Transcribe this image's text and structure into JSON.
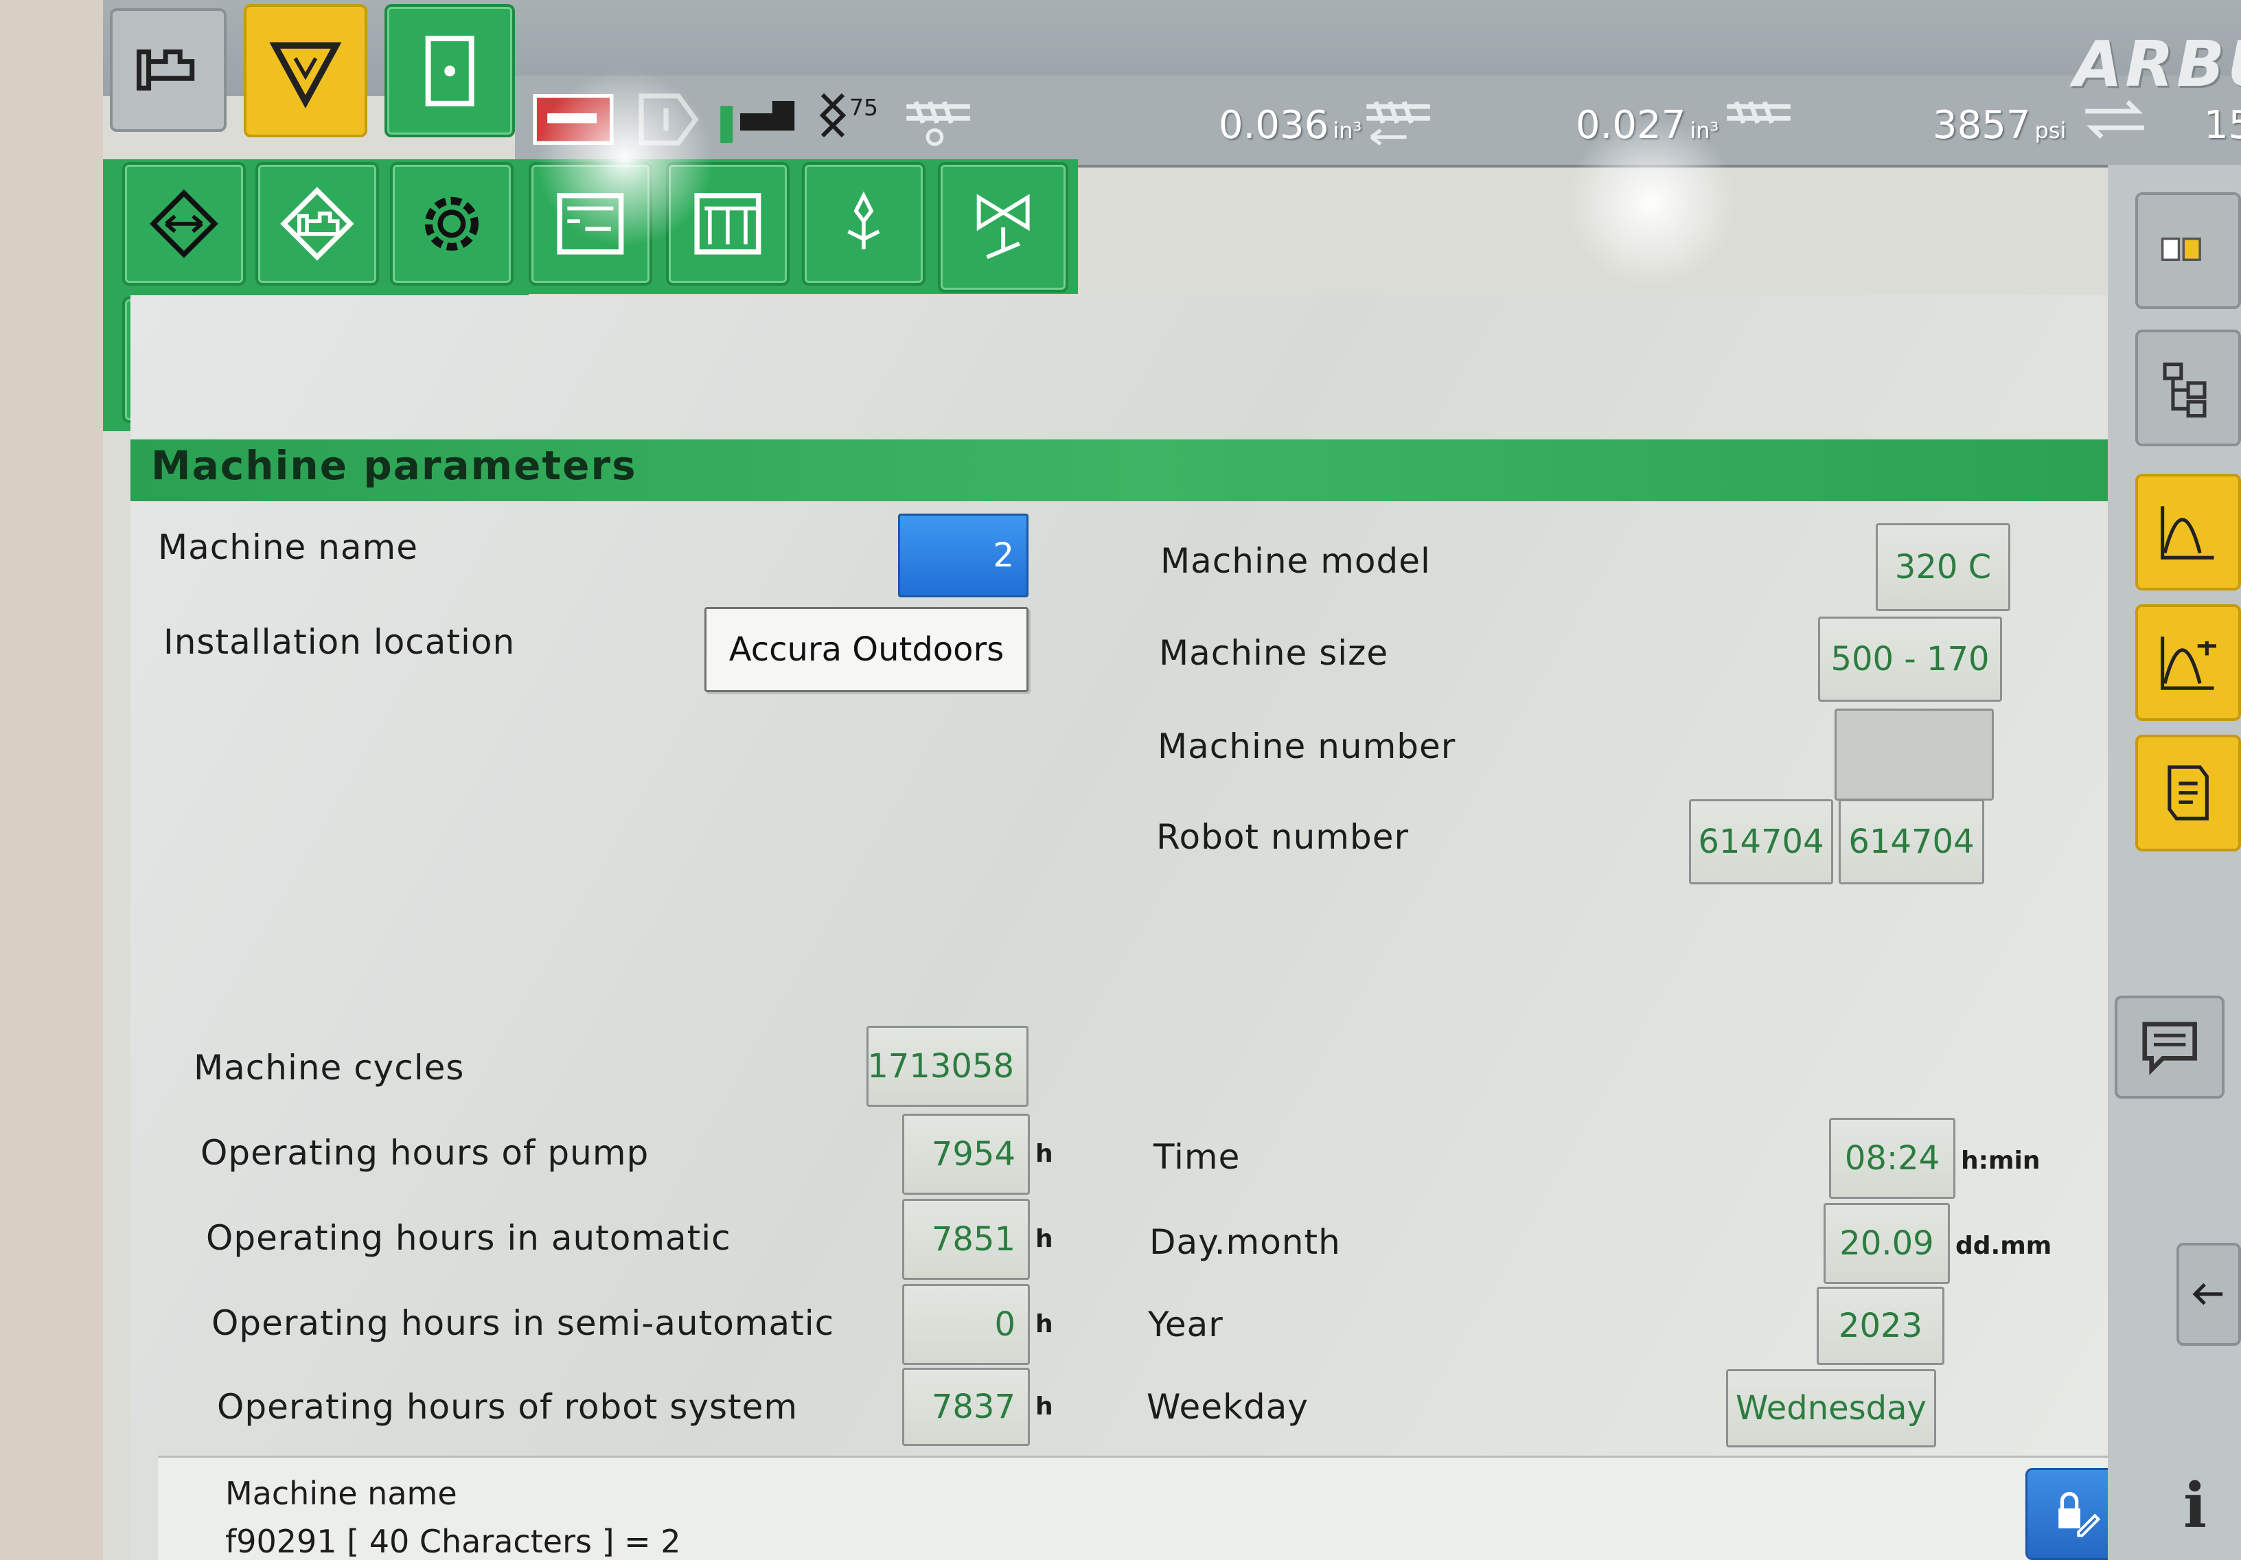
{
  "logo": {
    "text": "ARBU"
  },
  "statusbar": {
    "item1": {
      "value": "0.036",
      "unit": "in³"
    },
    "item2": {
      "value": "0.027",
      "unit": "in³"
    },
    "item3": {
      "value": "3857",
      "unit": "psi"
    },
    "item4": {
      "value": "15"
    },
    "percent_icon_text": "75 %"
  },
  "page": {
    "title": "Machine parameters"
  },
  "fields": {
    "machine_name": {
      "label": "Machine name",
      "value": "2"
    },
    "installation_location": {
      "label": "Installation location",
      "value": "Accura Outdoors"
    },
    "machine_model": {
      "label": "Machine model",
      "value": "320 C"
    },
    "machine_size": {
      "label": "Machine size",
      "value": "500 - 170"
    },
    "machine_number": {
      "label": "Machine number",
      "value": ""
    },
    "robot_number": {
      "label": "Robot number",
      "value1": "614704",
      "value2": "614704"
    },
    "machine_cycles": {
      "label": "Machine cycles",
      "value": "1713058"
    },
    "hours_pump": {
      "label": "Operating hours of pump",
      "value": "7954",
      "unit": "h"
    },
    "hours_automatic": {
      "label": "Operating hours in automatic",
      "value": "7851",
      "unit": "h"
    },
    "hours_semi": {
      "label": "Operating hours in semi-automatic",
      "value": "0",
      "unit": "h"
    },
    "hours_robot": {
      "label": "Operating hours of robot system",
      "value": "7837",
      "unit": "h"
    },
    "time": {
      "label": "Time",
      "value": "08:24",
      "unit": "h:min"
    },
    "day_month": {
      "label": "Day.month",
      "value": "20.09",
      "unit": "dd.mm"
    },
    "year": {
      "label": "Year",
      "value": "2023"
    },
    "weekday": {
      "label": "Weekday",
      "value": "Wednesday"
    }
  },
  "help": {
    "title": "Machine name",
    "text": "f90291 [ 40 Characters ] = 2"
  },
  "info_button": "i",
  "icons": {
    "tb_machine": "machine-icon",
    "tb_warning": "warning-triangle-icon",
    "tb_door": "door-icon",
    "tb_setup": "setup-icon",
    "tb_mold": "mold-diamond-icon",
    "tb_settings": "gear-icon",
    "tb_key": "key-panel-icon",
    "tb_tools": "tools-icon",
    "tb_ejector": "ejector-icon",
    "tb_valve": "valve-icon"
  },
  "colors": {
    "accent_green": "#2da657",
    "value_text": "#2c7c40",
    "active_blue": "#2a7fe0",
    "warning_yellow": "#f0c020"
  }
}
